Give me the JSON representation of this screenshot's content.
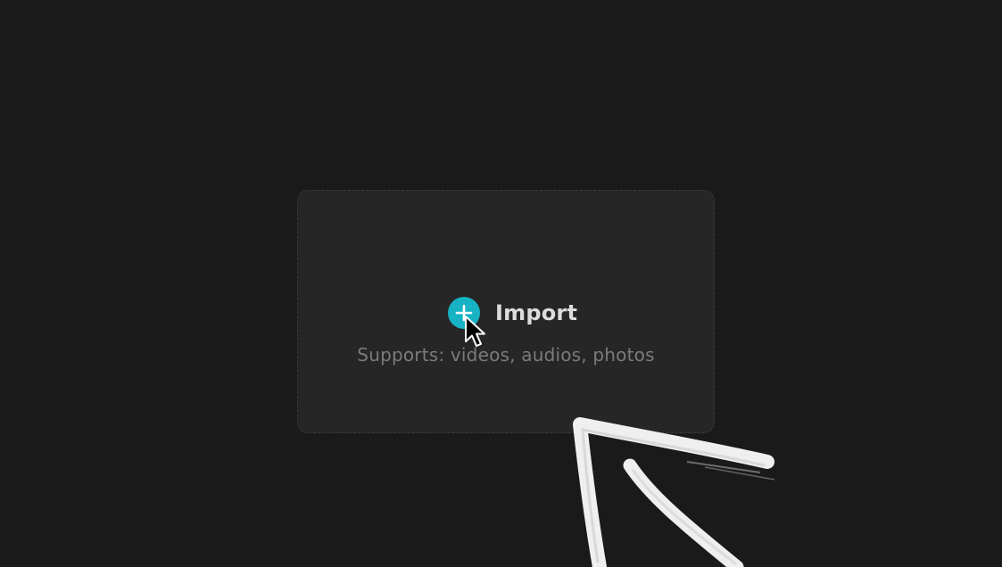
{
  "import_panel": {
    "button_label": "Import",
    "plus_icon": "plus-icon",
    "accent_color": "#17b3c4",
    "supports_text": "Supports: videos, audios, photos"
  },
  "pointer": {
    "icon": "mouse-cursor-icon"
  },
  "annotation": {
    "icon": "hand-drawn-arrow-icon",
    "color": "#f2f2f2"
  }
}
